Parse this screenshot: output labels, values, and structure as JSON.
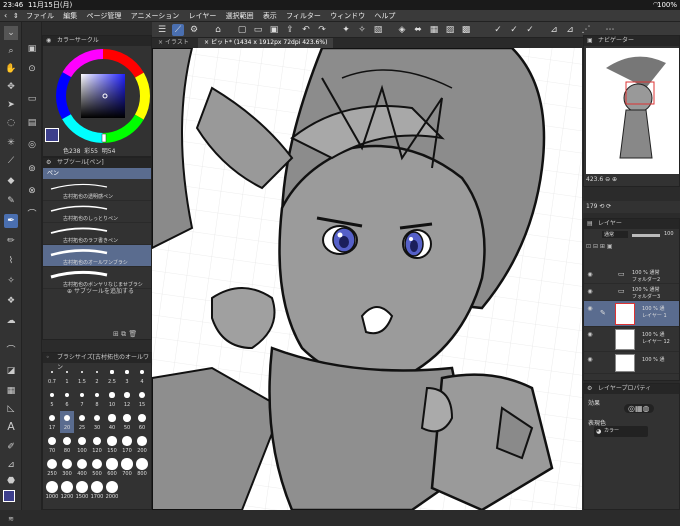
{
  "status": {
    "time": "23:46",
    "date": "11月15日(月)",
    "wifi": "wifi",
    "battery": "100%"
  },
  "menu": {
    "items": [
      "ファイル",
      "編集",
      "ページ管理",
      "アニメーション",
      "レイヤー",
      "選択範囲",
      "表示",
      "フィルター",
      "ウィンドウ",
      "ヘルプ"
    ]
  },
  "tabs": {
    "first": "イラスト",
    "second": "ピット* (1434 x 1912px 72dpi 423.6%)"
  },
  "color_panel": {
    "title": "カラーサークル",
    "values": {
      "h": "238",
      "s": "55",
      "v": "54"
    },
    "labels": {
      "h": "色",
      "s": "彩",
      "v": "明"
    },
    "main": "#3d3f8c",
    "sub": "#6a6ac0"
  },
  "subtool_panel": {
    "title": "サブツール[ペン]",
    "group": "ペン",
    "brushes": [
      "古村拓也の透明感ペン",
      "古村拓也のしっとりペン",
      "古村拓也のラフ書きペン",
      "古村拓也のオールワンブラシ",
      "古村拓也のボンヤリなじませブラシ"
    ],
    "selected": 3,
    "add_label": "サブツールを追加する"
  },
  "brushsize_panel": {
    "title": "ブラシサイズ[古村拓也のオールワン",
    "rows": [
      [
        "0.7",
        "1",
        "1.5",
        "2",
        "2.5",
        "3",
        "4"
      ],
      [
        "5",
        "6",
        "7",
        "8",
        "10",
        "12",
        "15"
      ],
      [
        "17",
        "20",
        "25",
        "30",
        "40",
        "50",
        "60"
      ],
      [
        "70",
        "80",
        "100",
        "120",
        "150",
        "170",
        "200"
      ],
      [
        "250",
        "300",
        "400",
        "500",
        "600",
        "700",
        "800"
      ],
      [
        "1000",
        "1200",
        "1500",
        "1700",
        "2000",
        "",
        ""
      ]
    ],
    "selected_size": "20"
  },
  "navigator": {
    "title": "ナビゲーター",
    "zoom": "423.6",
    "rotation": "179"
  },
  "layer_panel": {
    "title": "レイヤー",
    "blend": "通常",
    "opacity": "100",
    "layers": [
      {
        "name": "100 % 通常\nフォルダー2",
        "type": "folder"
      },
      {
        "name": "100 % 通常\nフォルダー3",
        "type": "folder"
      },
      {
        "name": "100 % 通\nレイヤー 1",
        "type": "layer",
        "selected": true
      },
      {
        "name": "100 % 通\nレイヤー 12",
        "type": "layer"
      },
      {
        "name": "100 % 通",
        "type": "layer"
      }
    ]
  },
  "layer_prop": {
    "title": "レイヤープロパティ",
    "effect": "効果",
    "expression": "表現色",
    "color_mode": "カラー"
  }
}
